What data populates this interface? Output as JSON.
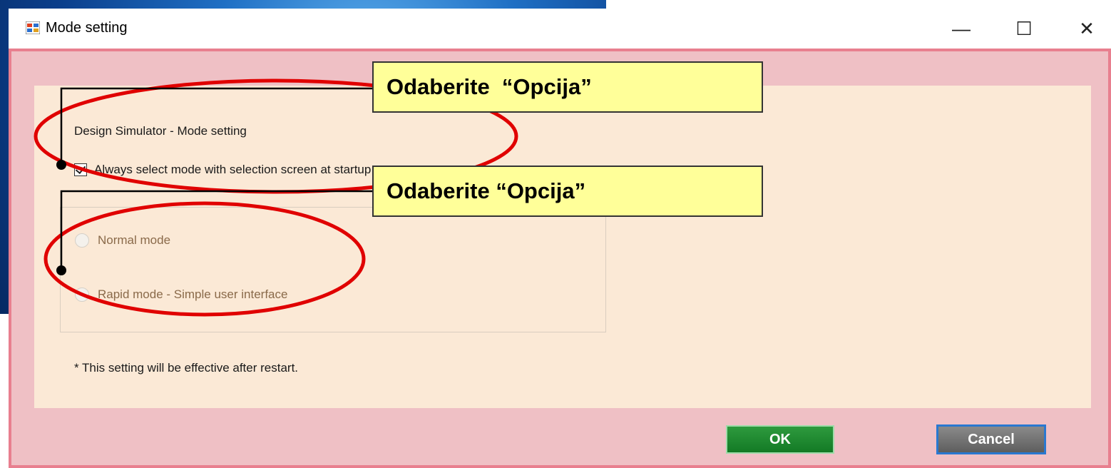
{
  "window": {
    "title": "Mode setting"
  },
  "controls": {
    "minimize": "—",
    "maximize": "☐",
    "close": "✕"
  },
  "panel": {
    "heading": "Design Simulator - Mode setting",
    "checkbox_label": "Always select mode with selection screen at startup",
    "checkbox_checked": true,
    "radios": [
      "Normal mode",
      "Rapid mode - Simple user interface"
    ],
    "note": "* This setting will be effective after restart."
  },
  "buttons": {
    "ok": "OK",
    "cancel": "Cancel"
  },
  "callouts": [
    "Odaberite  “Opcija”",
    "Odaberite “Opcija”"
  ],
  "colors": {
    "frame": "#efc0c5",
    "panel": "#fbe9d6",
    "callout": "#ffff99",
    "highlight": "#e00000",
    "ok": "#1f8a30"
  }
}
